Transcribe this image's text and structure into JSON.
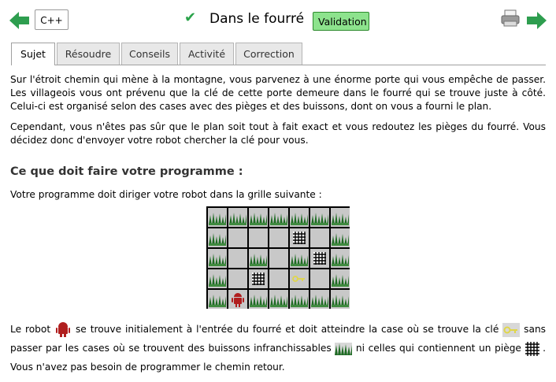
{
  "header": {
    "language": "C++",
    "title": "Dans le fourré",
    "validation": "Validation"
  },
  "tabs": [
    {
      "label": "Sujet",
      "active": true
    },
    {
      "label": "Résoudre",
      "active": false
    },
    {
      "label": "Conseils",
      "active": false
    },
    {
      "label": "Activité",
      "active": false
    },
    {
      "label": "Correction",
      "active": false
    }
  ],
  "content": {
    "p1": "Sur l'étroit chemin qui mène à la montagne, vous parvenez à une énorme porte qui vous empêche de passer. Les villageois vous ont prévenu que la clé de cette porte demeure dans le fourré qui se trouve juste à côté. Celui-ci est organisé selon des cases avec des pièges et des buissons, dont on vous a fourni le plan.",
    "p2": "Cependant, vous n'êtes pas sûr que le plan soit tout à fait exact et vous redoutez les pièges du fourré. Vous décidez donc d'envoyer votre robot chercher la clé pour vous.",
    "heading": "Ce que doit faire votre programme :",
    "p3": "Votre programme doit diriger votre robot dans la grille suivante :",
    "p4_a": "Le robot",
    "p4_b": "se trouve initialement à l'entrée du fourré et doit atteindre la case où se trouve la clé",
    "p4_c": "sans passer par les cases où se trouvent des buissons infranchissables",
    "p4_d": "ni celles qui contiennent un piège",
    "p4_e": ". Vous n'avez pas besoin de programmer le chemin retour."
  },
  "grid_map": [
    "BBBBBBB",
    "B...T.B",
    "B.B.BTB",
    "B.T.K.B",
    "BRBBBBB"
  ],
  "colors": {
    "accent_green": "#2e9e4f",
    "validation_bg": "#8de38d",
    "bush": "#1f6b24",
    "robot": "#b01e1e",
    "key": "#e0d64a"
  },
  "icons": [
    "back-arrow-icon",
    "forward-arrow-icon",
    "check-icon",
    "printer-icon",
    "bush-icon",
    "trap-icon",
    "key-icon",
    "robot-icon"
  ]
}
